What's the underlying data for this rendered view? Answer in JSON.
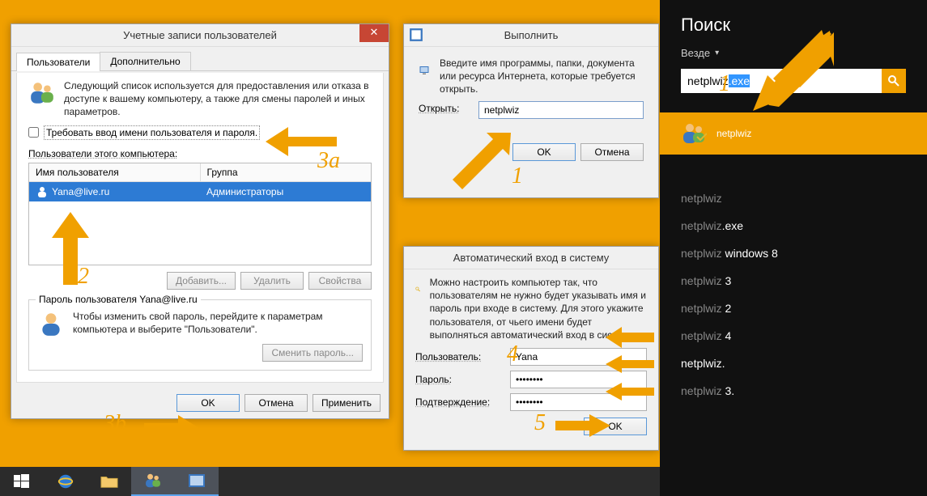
{
  "user_accounts": {
    "title": "Учетные записи пользователей",
    "tabs": {
      "users": "Пользователи",
      "advanced": "Дополнительно"
    },
    "description": "Следующий список используется для предоставления или отказа в доступе к вашему компьютеру, а также для смены паролей и иных параметров.",
    "require_login_label": "Требовать ввод имени пользователя и пароля.",
    "require_login_checked": false,
    "users_of_label": "Пользователи этого компьютера:",
    "columns": {
      "user": "Имя пользователя",
      "group": "Группа"
    },
    "row": {
      "user": "Yana@live.ru",
      "group": "Администраторы"
    },
    "buttons": {
      "add": "Добавить...",
      "remove": "Удалить",
      "properties": "Свойства"
    },
    "pw_group_title": "Пароль пользователя Yana@live.ru",
    "pw_help": "Чтобы изменить свой пароль, перейдите к параметрам компьютера и выберите \"Пользователи\".",
    "change_pw": "Сменить пароль...",
    "footer": {
      "ok": "OK",
      "cancel": "Отмена",
      "apply": "Применить"
    }
  },
  "run": {
    "title": "Выполнить",
    "hint": "Введите имя программы, папки, документа или ресурса Интернета, которые требуется открыть.",
    "open_label": "Открыть:",
    "value": "netplwiz",
    "ok": "OK",
    "cancel": "Отмена"
  },
  "autologin": {
    "title": "Автоматический вход в систему",
    "hint": "Можно настроить компьютер так, что пользователям не нужно будет указывать имя и пароль при входе в систему. Для этого укажите пользователя, от чьего имени будет выполняться автоматический вход в систему:",
    "user_label": "Пользователь:",
    "user": "Yana",
    "password_label": "Пароль:",
    "password": "••••••••",
    "confirm_label": "Подтверждение:",
    "confirm": "••••••••",
    "ok": "OK"
  },
  "search": {
    "title": "Поиск",
    "scope": "Везде",
    "query_prefix": "netplwiz",
    "query_sel": ".exe",
    "top_result": "netplwiz",
    "suggestions": [
      {
        "pre": "netplwiz",
        "post": ""
      },
      {
        "pre": "netplwiz",
        "post": ".exe"
      },
      {
        "pre": "netplwiz ",
        "post": "windows 8"
      },
      {
        "pre": "netplwiz ",
        "post": "3"
      },
      {
        "pre": "netplwiz ",
        "post": "2"
      },
      {
        "pre": "netplwiz ",
        "post": "4"
      },
      {
        "pre": "netplwiz",
        "post": "."
      },
      {
        "pre": "netplwiz ",
        "post": "3."
      }
    ]
  },
  "annotations": {
    "n1": "1",
    "n2": "2",
    "n3a": "3a",
    "n3b": "3b",
    "n4": "4",
    "n5": "5",
    "n1b": "1"
  },
  "colors": {
    "accent": "#f0a000",
    "select": "#2d7bd4"
  }
}
